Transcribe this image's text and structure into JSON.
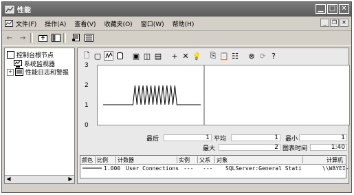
{
  "window": {
    "title": "性能"
  },
  "menu": {
    "items": [
      "文件(F)",
      "操作(A)",
      "查看(V)",
      "收藏夹(O)",
      "窗口(W)",
      "帮助(H)"
    ]
  },
  "tree": {
    "root": "控制台根节点",
    "children": [
      "系统监视器",
      "性能日志和警报"
    ]
  },
  "chart_data": {
    "type": "line",
    "y_ticks": [
      "3",
      "2",
      "1",
      "0"
    ],
    "ylim": [
      0,
      3
    ],
    "series": [
      {
        "name": "User Connections",
        "values": [
          1,
          1,
          1,
          1,
          1,
          1,
          1,
          1,
          1,
          1,
          1,
          1,
          1,
          1,
          1,
          1,
          2,
          1,
          2,
          1,
          2,
          1,
          2,
          1,
          2,
          1,
          2,
          1,
          2,
          1,
          2,
          1,
          2,
          1,
          2,
          1,
          2,
          1,
          1,
          1,
          1,
          1,
          1,
          1,
          1,
          1,
          1,
          1,
          1,
          1
        ]
      }
    ]
  },
  "stats": {
    "last_label": "最后",
    "last_value": "1",
    "avg_label": "平均",
    "avg_value": "1",
    "min_label": "最小",
    "min_value": "1",
    "max_label": "最大",
    "max_value": "2",
    "duration_label": "图表时间",
    "duration_value": "1:40"
  },
  "legend": {
    "headers": [
      "颜色",
      "比例",
      "计数器",
      "实例",
      "父系",
      "对象",
      "计算机"
    ],
    "rows": [
      {
        "scale": "1.000",
        "counter": "User Connections",
        "instance": "---",
        "parent": "---",
        "object": "SQLServer:General Stati...",
        "computer": "\\\\WAYEI-"
      }
    ]
  }
}
